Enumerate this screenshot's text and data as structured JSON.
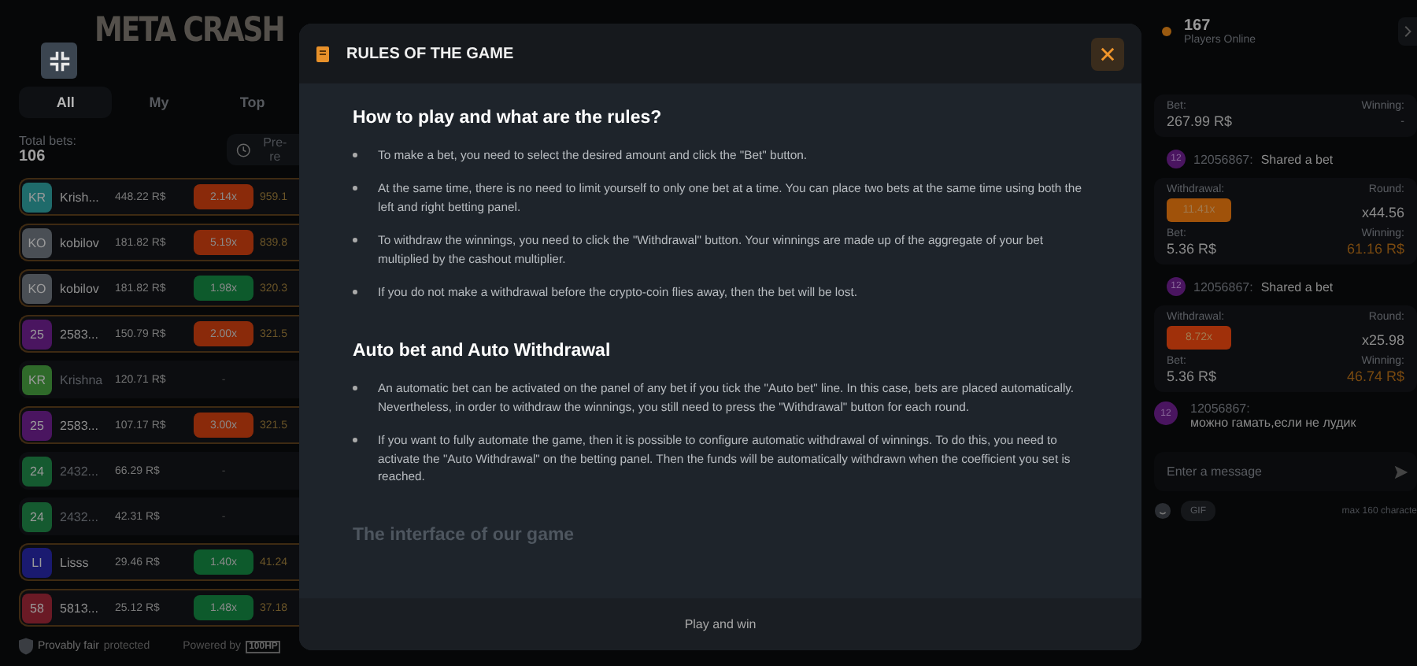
{
  "logo": "META CRASH",
  "tabs": [
    {
      "label": "All",
      "selected": true
    },
    {
      "label": "My",
      "selected": false
    },
    {
      "label": "Top",
      "selected": false
    }
  ],
  "total_bets": {
    "label": "Total bets:",
    "value": "106"
  },
  "pre_round_button": "Pre-re",
  "bets": [
    {
      "avatar": "KR",
      "color": "#1f6b6b",
      "name": "Krish...",
      "bet": "448.22 R$",
      "multiplier": "2.14x",
      "kind": "loss",
      "win": "959.1",
      "highlighted": true
    },
    {
      "avatar": "KO",
      "color": "#4a4f55",
      "name": "kobilov",
      "bet": "181.82 R$",
      "multiplier": "5.19x",
      "kind": "loss",
      "win": "839.8",
      "highlighted": true
    },
    {
      "avatar": "KO",
      "color": "#4a4f55",
      "name": "kobilov",
      "bet": "181.82 R$",
      "multiplier": "1.98x",
      "kind": "win",
      "win": "320.3",
      "highlighted": true
    },
    {
      "avatar": "25",
      "color": "#4a1560",
      "name": "2583...",
      "bet": "150.79 R$",
      "multiplier": "2.00x",
      "kind": "loss",
      "win": "321.5",
      "highlighted": true
    },
    {
      "avatar": "KR",
      "color": "#2f6a2a",
      "name": "Krishna",
      "bet": "120.71 R$",
      "multiplier": "-",
      "kind": "pending",
      "highlighted": false
    },
    {
      "avatar": "25",
      "color": "#4a1560",
      "name": "2583...",
      "bet": "107.17 R$",
      "multiplier": "3.00x",
      "kind": "loss",
      "win": "321.5",
      "highlighted": true
    },
    {
      "avatar": "24",
      "color": "#155a30",
      "name": "2432...",
      "bet": "66.29 R$",
      "multiplier": "-",
      "kind": "pending",
      "highlighted": false
    },
    {
      "avatar": "24",
      "color": "#155a30",
      "name": "2432...",
      "bet": "42.31 R$",
      "multiplier": "-",
      "kind": "pending",
      "highlighted": false
    },
    {
      "avatar": "LI",
      "color": "#1a1a70",
      "name": "Lisss",
      "bet": "29.46 R$",
      "multiplier": "1.40x",
      "kind": "win",
      "win": "41.24",
      "highlighted": true
    },
    {
      "avatar": "58",
      "color": "#6a1a25",
      "name": "5813...",
      "bet": "25.12 R$",
      "multiplier": "1.48x",
      "kind": "win",
      "win": "37.18",
      "highlighted": true
    }
  ],
  "footer": {
    "provably": "Provably fair",
    "protected": "protected",
    "powered": "Powered by",
    "brand": "100HP"
  },
  "modal": {
    "title": "RULES OF THE GAME",
    "sections": [
      {
        "heading": "How to play and what are the rules?",
        "faded": false,
        "items": [
          "To make a bet, you need to select the desired amount and click the \"Bet\" button.",
          "At the same time, there is no need to limit yourself to only one bet at a time. You can place two bets at the same time using both the left and right betting panel.",
          "To withdraw the winnings, you need to click the \"Withdrawal\" button. Your winnings are made up of the aggregate of your bet multiplied by the cashout multiplier.",
          "If you do not make a withdrawal before the crypto-coin flies away, then the bet will be lost."
        ]
      },
      {
        "heading": "Auto bet and Auto Withdrawal",
        "faded": false,
        "items": [
          "An automatic bet can be activated on the panel of any bet if you tick the \"Auto bet\" line. In this case, bets are placed automatically. Nevertheless, in order to withdraw the winnings, you still need to press the \"Withdrawal\" button for each round.",
          "If you want to fully automate the game, then it is possible to configure automatic withdrawal of winnings. To do this, you need to activate the \"Auto Withdrawal\" on the betting panel. Then the funds will be automatically withdrawn when the coefficient you set is reached."
        ]
      },
      {
        "heading": "The interface of our game",
        "faded": true
      }
    ],
    "footer_button": "Play and win"
  },
  "online": {
    "count": "167",
    "label": "Players Online"
  },
  "top_card": {
    "bet_label": "Bet:",
    "bet": "267.99 R$",
    "win_label": "Winning:",
    "win": "-"
  },
  "shared": [
    {
      "avatar": "12",
      "user": "12056867:",
      "text": "Shared a bet",
      "withdraw_label": "Withdrawal:",
      "multiplier": "11.41x",
      "color": "#a0520a",
      "round_label": "Round:",
      "round": "x44.56",
      "bet_label": "Bet:",
      "bet": "5.36 R$",
      "win_label": "Winning:",
      "win": "61.16 R$"
    },
    {
      "avatar": "12",
      "user": "12056867:",
      "text": "Shared a bet",
      "withdraw_label": "Withdrawal:",
      "multiplier": "8.72x",
      "color": "#a0300a",
      "round_label": "Round:",
      "round": "x25.98",
      "bet_label": "Bet:",
      "bet": "5.36 R$",
      "win_label": "Winning:",
      "win": "46.74 R$"
    }
  ],
  "message": {
    "avatar": "12",
    "user": "12056867:",
    "text": "можно гамать,если не лудик"
  },
  "chat_input": {
    "placeholder": "Enter a message"
  },
  "gif_button": "GIF",
  "char_limit": "max 160 characte"
}
